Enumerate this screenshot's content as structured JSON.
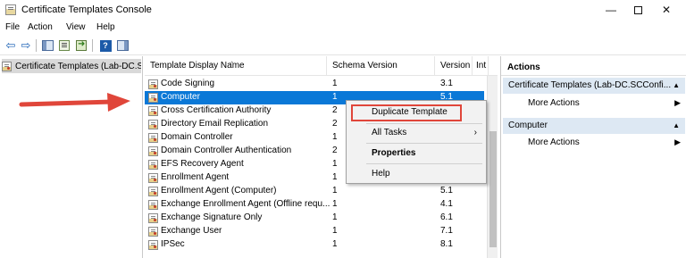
{
  "window": {
    "title": "Certificate Templates Console",
    "minimize": "—",
    "close": "✕"
  },
  "menu": [
    "File",
    "Action",
    "View",
    "Help"
  ],
  "toolbar": {
    "back_icon": "back-arrow-icon",
    "forward_icon": "forward-arrow-icon",
    "help_label": "?"
  },
  "tree": {
    "root_label": "Certificate Templates (Lab-DC.S"
  },
  "list": {
    "columns": [
      "Template Display Name",
      "Schema Version",
      "Version",
      "Int"
    ],
    "rows": [
      {
        "name": "Code Signing",
        "schema": "1",
        "version": "3.1"
      },
      {
        "name": "Computer",
        "schema": "1",
        "version": "5.1",
        "selected": true
      },
      {
        "name": "Cross Certification Authority",
        "schema": "2",
        "version": ""
      },
      {
        "name": "Directory Email Replication",
        "schema": "2",
        "version": ""
      },
      {
        "name": "Domain Controller",
        "schema": "1",
        "version": ""
      },
      {
        "name": "Domain Controller Authentication",
        "schema": "2",
        "version": ""
      },
      {
        "name": "EFS Recovery Agent",
        "schema": "1",
        "version": ""
      },
      {
        "name": "Enrollment Agent",
        "schema": "1",
        "version": ""
      },
      {
        "name": "Enrollment Agent (Computer)",
        "schema": "1",
        "version": "5.1"
      },
      {
        "name": "Exchange Enrollment Agent (Offline requ...",
        "schema": "1",
        "version": "4.1"
      },
      {
        "name": "Exchange Signature Only",
        "schema": "1",
        "version": "6.1"
      },
      {
        "name": "Exchange User",
        "schema": "1",
        "version": "7.1"
      },
      {
        "name": "IPSec",
        "schema": "1",
        "version": "8.1"
      }
    ]
  },
  "context_menu": {
    "duplicate": "Duplicate Template",
    "all_tasks": "All Tasks",
    "properties": "Properties",
    "help": "Help",
    "submenu_arrow": "›"
  },
  "actions": {
    "title": "Actions",
    "section1": "Certificate Templates (Lab-DC.SCConfi...",
    "section1_item": "More Actions",
    "section2": "Computer",
    "section2_item": "More Actions",
    "collapse_glyph": "▲",
    "item_arrow": "▶"
  },
  "colors": {
    "selection": "#0a78d7",
    "highlight_box": "#e0463a",
    "section_bg": "#dde8f3"
  }
}
